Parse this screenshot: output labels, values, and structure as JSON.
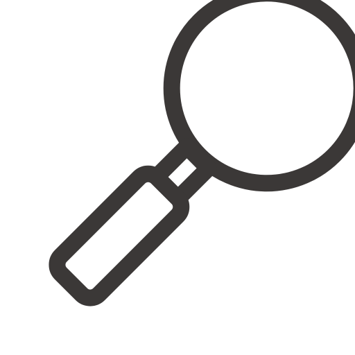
{
  "icon": {
    "name": "magnifying-glass-icon",
    "stroke_color": "#3b3837",
    "fill_color": "#ffffff",
    "background_color": "#ffffff"
  }
}
